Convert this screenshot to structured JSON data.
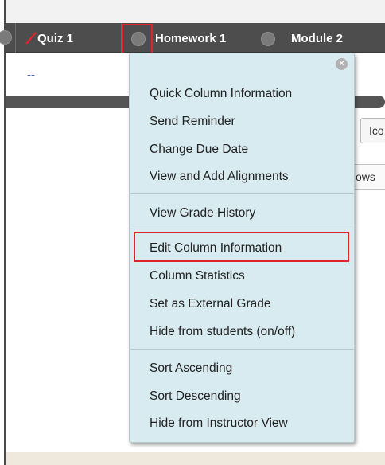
{
  "grade_center": {
    "columns": [
      {
        "label": "Quiz 1",
        "icon": "slash-icon"
      },
      {
        "label": "Homework 1",
        "icon": "chevron-circle-icon"
      },
      {
        "label": "Module 2",
        "icon": "chevron-circle-icon"
      }
    ],
    "cell_value": "--",
    "peek_button_label": "Ico",
    "peek_text": "ows"
  },
  "menu": {
    "close_glyph": "×",
    "groups": [
      [
        "Quick Column Information",
        "Send Reminder",
        "Change Due Date",
        "View and Add Alignments"
      ],
      [
        "View Grade History"
      ],
      [
        "Edit Column Information",
        "Column Statistics",
        "Set as External Grade",
        "Hide from students (on/off)"
      ],
      [
        "Sort Ascending",
        "Sort Descending",
        "Hide from Instructor View"
      ]
    ],
    "highlighted_item": "Edit Column Information"
  },
  "colors": {
    "header_bg": "#4d4d4d",
    "menu_bg": "#d8ebf1",
    "highlight_red": "#e0242b",
    "link_blue": "#1e3d8f",
    "quiz_slash_red": "#e0242b"
  }
}
